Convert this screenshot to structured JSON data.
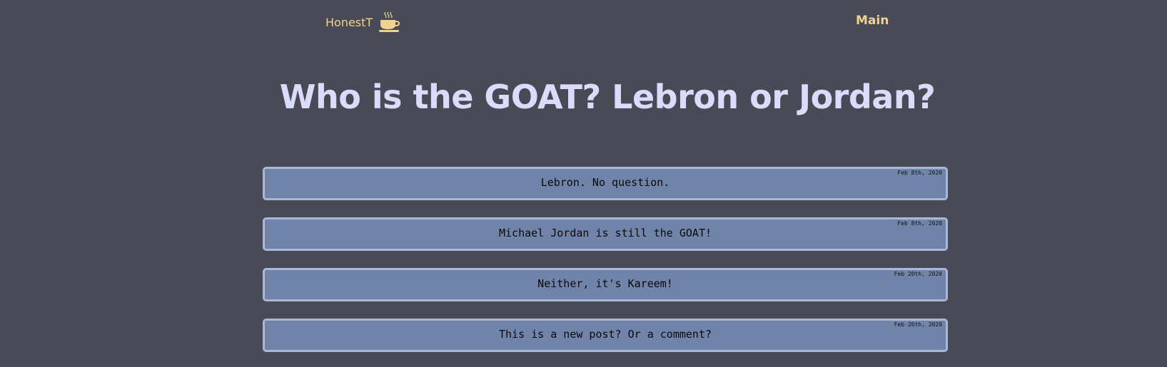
{
  "header": {
    "brand_label": "HonestT",
    "brand_icon": "hot-coffee-cup-icon",
    "nav_main_label": "Main"
  },
  "colors": {
    "background": "#484a56",
    "accent": "#f2d28f",
    "title": "#d9dcfb",
    "post_fill": "#7083a8",
    "post_border": "#aab8d6"
  },
  "thread": {
    "title": "Who is the GOAT? Lebron or Jordan?"
  },
  "posts": [
    {
      "text": "Lebron. No question.",
      "date": "Feb 8th, 2020"
    },
    {
      "text": "Michael Jordan is still the GOAT!",
      "date": "Feb 8th, 2020"
    },
    {
      "text": "Neither, it's Kareem!",
      "date": "Feb 20th, 2020"
    },
    {
      "text": "This is a new post? Or a comment?",
      "date": "Feb 26th, 2020"
    }
  ]
}
